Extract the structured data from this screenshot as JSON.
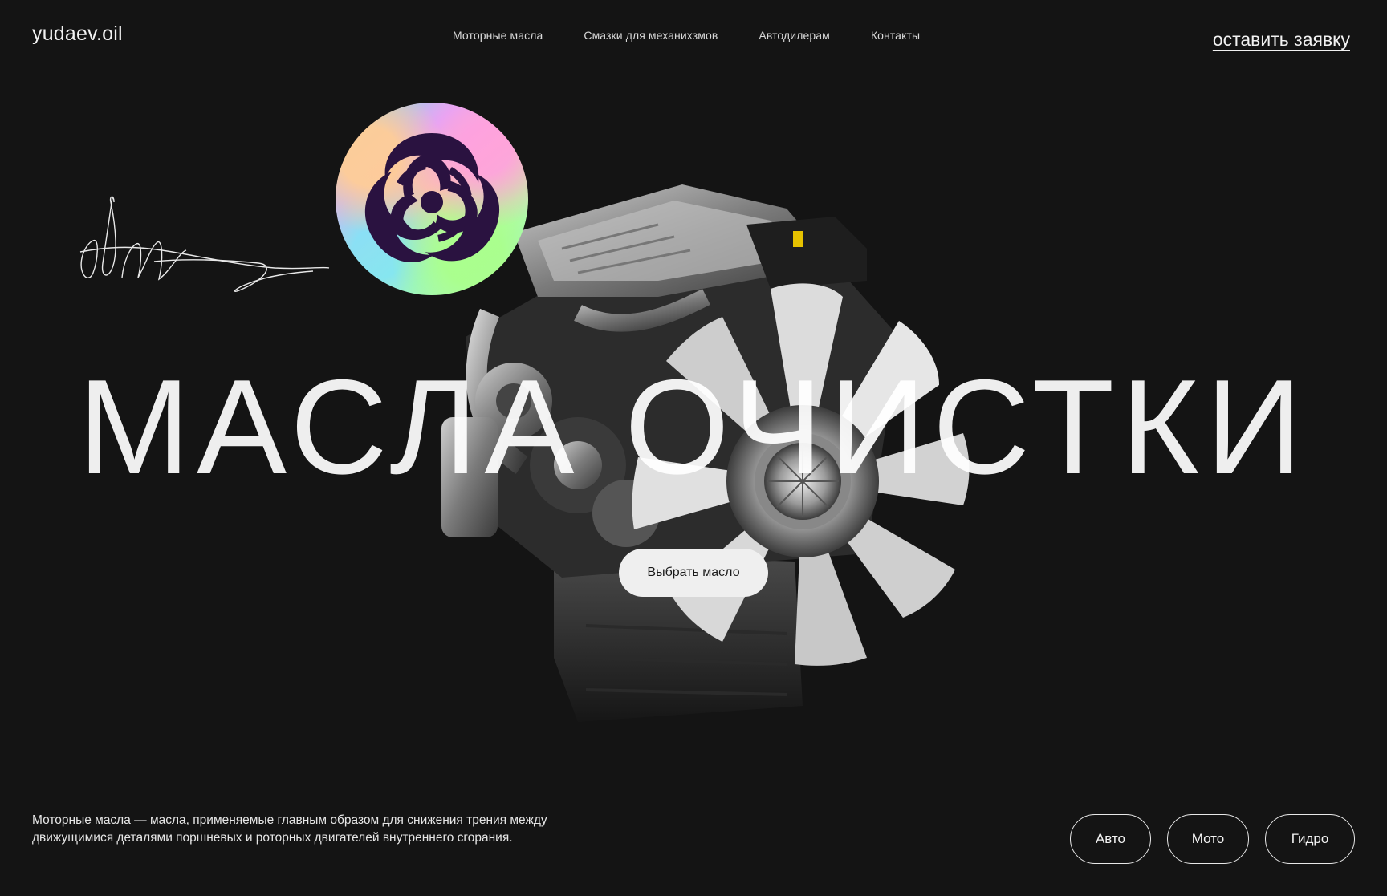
{
  "header": {
    "logo": "yudaev.oil",
    "nav": [
      {
        "label": "Моторные масла"
      },
      {
        "label": "Смазки для механихзмов"
      },
      {
        "label": "Автодилерам"
      },
      {
        "label": "Контакты"
      }
    ],
    "cta_label": "оставить заявку"
  },
  "hero": {
    "title": "МАСЛА ОЧИСТКИ",
    "badge_icon": "biohazard-icon",
    "choose_button": "Выбрать масло"
  },
  "footer": {
    "description": "Моторные масла — масла, применяемые главным образом для снижения трения между движущимися деталями поршневых и роторных двигателей внутреннего сгорания.",
    "categories": [
      {
        "label": "Авто"
      },
      {
        "label": "Мото"
      },
      {
        "label": "Гидро"
      }
    ]
  },
  "colors": {
    "background": "#141414",
    "text": "#f2f2f2",
    "button_bg": "#efefef",
    "biohazard": "#2a1240"
  }
}
